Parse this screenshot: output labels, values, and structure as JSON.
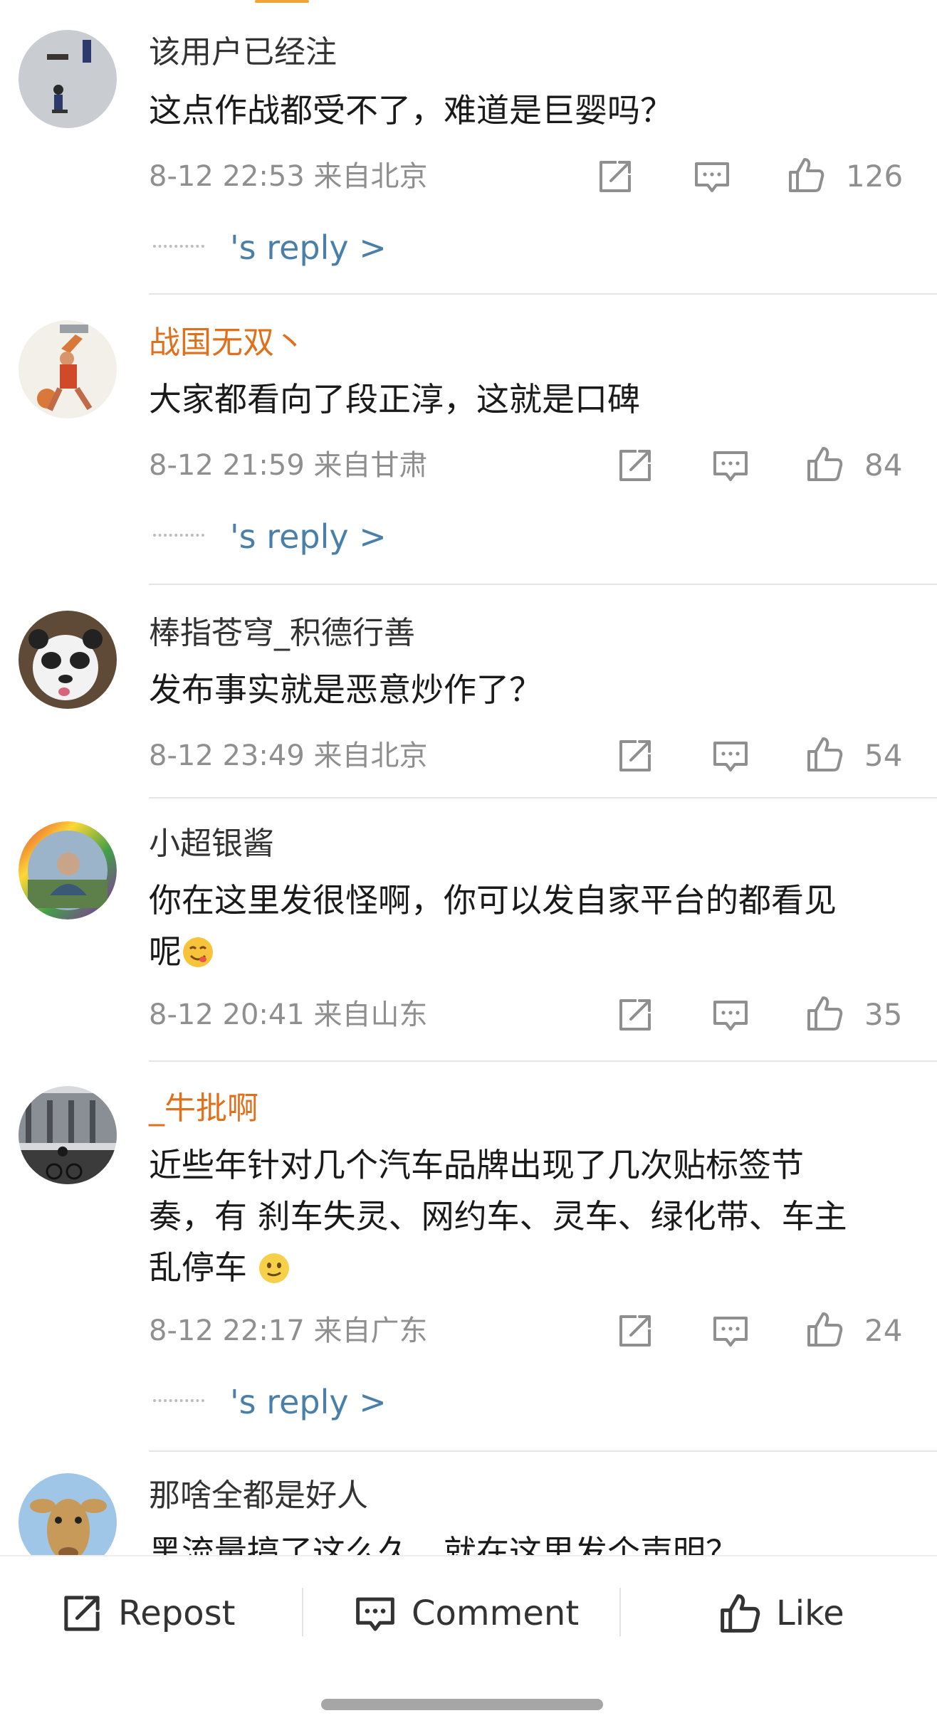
{
  "comments": [
    {
      "username": "该用户已经注",
      "text": "这点作战都受不了，难道是巨婴吗？",
      "time": "8-12 22:53",
      "location": "来自北京",
      "likes": "126",
      "reply_label": "'s reply >"
    },
    {
      "username": "战国无双丶",
      "text": "大家都看向了段正淳，这就是口碑",
      "time": "8-12 21:59",
      "location": "来自甘肃",
      "likes": "84",
      "reply_label": "'s reply >"
    },
    {
      "username": "棒指苍穹_积德行善",
      "text": "发布事实就是恶意炒作了？",
      "time": "8-12 23:49",
      "location": "来自北京",
      "likes": "54"
    },
    {
      "username": "小超银酱",
      "text": "你在这里发很怪啊，你可以发自家平台的都看见",
      "text_cont": "呢",
      "time": "8-12 20:41",
      "location": "来自山东",
      "likes": "35"
    },
    {
      "username": "_牛批啊",
      "text_line1": "近些年针对几个汽车品牌出现了几次贴标签节",
      "text_line2": "奏，有 刹车失灵、网约车、灵车、绿化带、车主",
      "text_line3": "乱停车",
      "time": "8-12 22:17",
      "location": "来自广东",
      "likes": "24",
      "reply_label": "'s reply >"
    },
    {
      "username": "那啥全都是好人",
      "text": "黑流量搞了这么久，就在这里发个声明？"
    }
  ],
  "bottom_bar": {
    "repost_label": "Repost",
    "comment_label": "Comment",
    "like_label": "Like"
  },
  "colors": {
    "username_orange": "#e0701c",
    "reply_link": "#4a7fa8",
    "meta_gray": "#8f8f8f"
  },
  "icons": [
    "repost-icon",
    "comment-icon",
    "like-icon",
    "emoji-yum-icon",
    "emoji-slight-smile-icon"
  ]
}
